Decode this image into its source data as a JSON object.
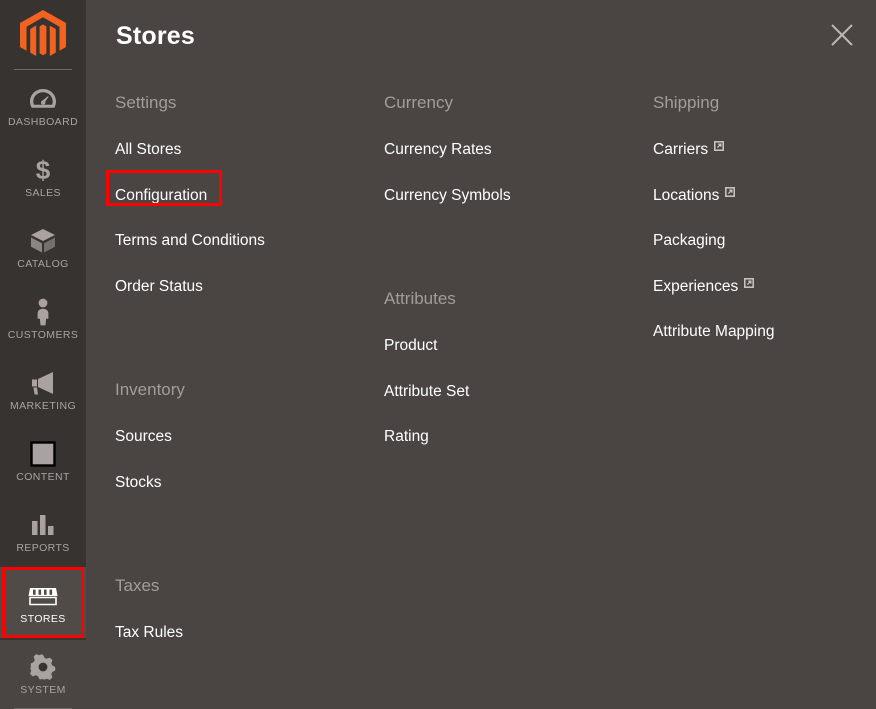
{
  "colors": {
    "sidebar_bg": "#373330",
    "panel_bg": "#4a4542",
    "active_bg": "#504b47",
    "highlight": "#ff0000",
    "brand_orange": "#f26322",
    "muted_text": "#a39c99",
    "white_text": "#ffffff"
  },
  "sidebar": {
    "logo": "magento-logo-icon",
    "items": [
      {
        "label": "DASHBOARD",
        "icon": "dashboard-gauge-icon",
        "active": false
      },
      {
        "label": "SALES",
        "icon": "dollar-sign-icon",
        "active": false
      },
      {
        "label": "CATALOG",
        "icon": "box-package-icon",
        "active": false
      },
      {
        "label": "CUSTOMERS",
        "icon": "person-icon",
        "active": false
      },
      {
        "label": "MARKETING",
        "icon": "megaphone-icon",
        "active": false
      },
      {
        "label": "CONTENT",
        "icon": "layout-page-icon",
        "active": false
      },
      {
        "label": "REPORTS",
        "icon": "bar-chart-icon",
        "active": false
      },
      {
        "label": "STORES",
        "icon": "storefront-awning-icon",
        "active": true
      },
      {
        "label": "SYSTEM",
        "icon": "gear-icon",
        "active": false
      }
    ]
  },
  "panel": {
    "title": "Stores",
    "close_icon": "close-x-icon",
    "columns": [
      {
        "groups": [
          {
            "title": "Settings",
            "links": [
              {
                "label": "All Stores",
                "external": false
              },
              {
                "label": "Configuration",
                "external": false,
                "highlighted": true
              },
              {
                "label": "Terms and Conditions",
                "external": false
              },
              {
                "label": "Order Status",
                "external": false
              }
            ]
          },
          {
            "title": "Inventory",
            "links": [
              {
                "label": "Sources",
                "external": false
              },
              {
                "label": "Stocks",
                "external": false
              }
            ]
          },
          {
            "title": "Taxes",
            "links": [
              {
                "label": "Tax Rules",
                "external": false
              }
            ]
          }
        ]
      },
      {
        "groups": [
          {
            "title": "Currency",
            "links": [
              {
                "label": "Currency Rates",
                "external": false
              },
              {
                "label": "Currency Symbols",
                "external": false
              }
            ]
          },
          {
            "title": "Attributes",
            "links": [
              {
                "label": "Product",
                "external": false
              },
              {
                "label": "Attribute Set",
                "external": false
              },
              {
                "label": "Rating",
                "external": false
              }
            ]
          }
        ]
      },
      {
        "groups": [
          {
            "title": "Shipping",
            "links": [
              {
                "label": "Carriers",
                "external": true
              },
              {
                "label": "Locations",
                "external": true
              },
              {
                "label": "Packaging",
                "external": false
              },
              {
                "label": "Experiences",
                "external": true
              },
              {
                "label": "Attribute Mapping",
                "external": false
              }
            ]
          }
        ]
      }
    ]
  }
}
